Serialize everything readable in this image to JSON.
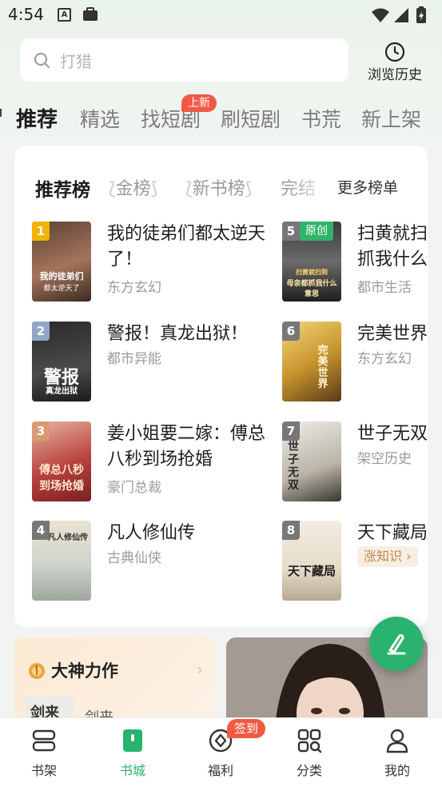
{
  "status_bar": {
    "time": "4:54",
    "a_badge": "A"
  },
  "search": {
    "placeholder": "打猎",
    "history_label": "浏览历史"
  },
  "tabs": [
    {
      "label": "推荐",
      "active": true
    },
    {
      "label": "精选"
    },
    {
      "label": "找短剧",
      "badge": "上新"
    },
    {
      "label": "刷短剧"
    },
    {
      "label": "书荒"
    },
    {
      "label": "新上架"
    }
  ],
  "rank": {
    "tabs": [
      "推荐榜",
      "金榜",
      "新书榜",
      "完结"
    ],
    "more": "更多榜单",
    "books": [
      {
        "rank": "1",
        "title_lines": [
          "我的徒弟们都太逆天",
          "了！"
        ],
        "genre": "东方玄幻",
        "cover_text": "我的徒弟们",
        "cover_sub": "都太逆天了",
        "rank_color": "#f2b200"
      },
      {
        "rank": "2",
        "title_lines": [
          "警报！真龙出狱！"
        ],
        "genre": "都市异能",
        "cover_text": "警报",
        "cover_sub": "真龙出狱",
        "rank_color": "#8fa6c8"
      },
      {
        "rank": "3",
        "title_lines": [
          "姜小姐要二嫁：傅总",
          "八秒到场抢婚"
        ],
        "genre": "豪门总裁",
        "cover_text": "傅总八秒",
        "cover_sub": "到场抢婚",
        "rank_color": "#d79a73"
      },
      {
        "rank": "4",
        "title_lines": [
          "凡人修仙传"
        ],
        "genre": "古典仙侠",
        "cover_text": "凡人修仙传",
        "cover_sub": "",
        "rank_color": "#777777"
      },
      {
        "rank": "5",
        "title_lines": [
          "扫黄就扫",
          "抓我什么"
        ],
        "genre": "都市生活",
        "cover_text": "扫黄就扫到",
        "cover_sub": "母亲都抓我什么意思",
        "rank_color": "#777777",
        "tag": "原创"
      },
      {
        "rank": "6",
        "title_lines": [
          "完美世界"
        ],
        "genre": "东方玄幻",
        "cover_text": "完美世界",
        "cover_sub": "",
        "rank_color": "#777777"
      },
      {
        "rank": "7",
        "title_lines": [
          "世子无双"
        ],
        "genre": "架空历史",
        "cover_text": "世子无双",
        "cover_sub": "",
        "rank_color": "#777777"
      },
      {
        "rank": "8",
        "title_lines": [
          "天下藏局"
        ],
        "genre": "",
        "cover_text": "天下藏局",
        "cover_sub": "",
        "rank_color": "#777777",
        "pill": "涨知识 ›"
      }
    ]
  },
  "god_card": {
    "title": "大神力作",
    "arrow": "›",
    "book": "剑来",
    "cover_text": "剑来"
  },
  "nav": [
    {
      "label": "书架",
      "icon": "bookshelf-icon"
    },
    {
      "label": "书城",
      "icon": "bookstore-icon",
      "active": true
    },
    {
      "label": "福利",
      "icon": "welfare-icon",
      "badge": "签到"
    },
    {
      "label": "分类",
      "icon": "category-icon"
    },
    {
      "label": "我的",
      "icon": "profile-icon"
    }
  ],
  "colors": {
    "accent": "#2ab26f",
    "badge": "#f05a45"
  }
}
